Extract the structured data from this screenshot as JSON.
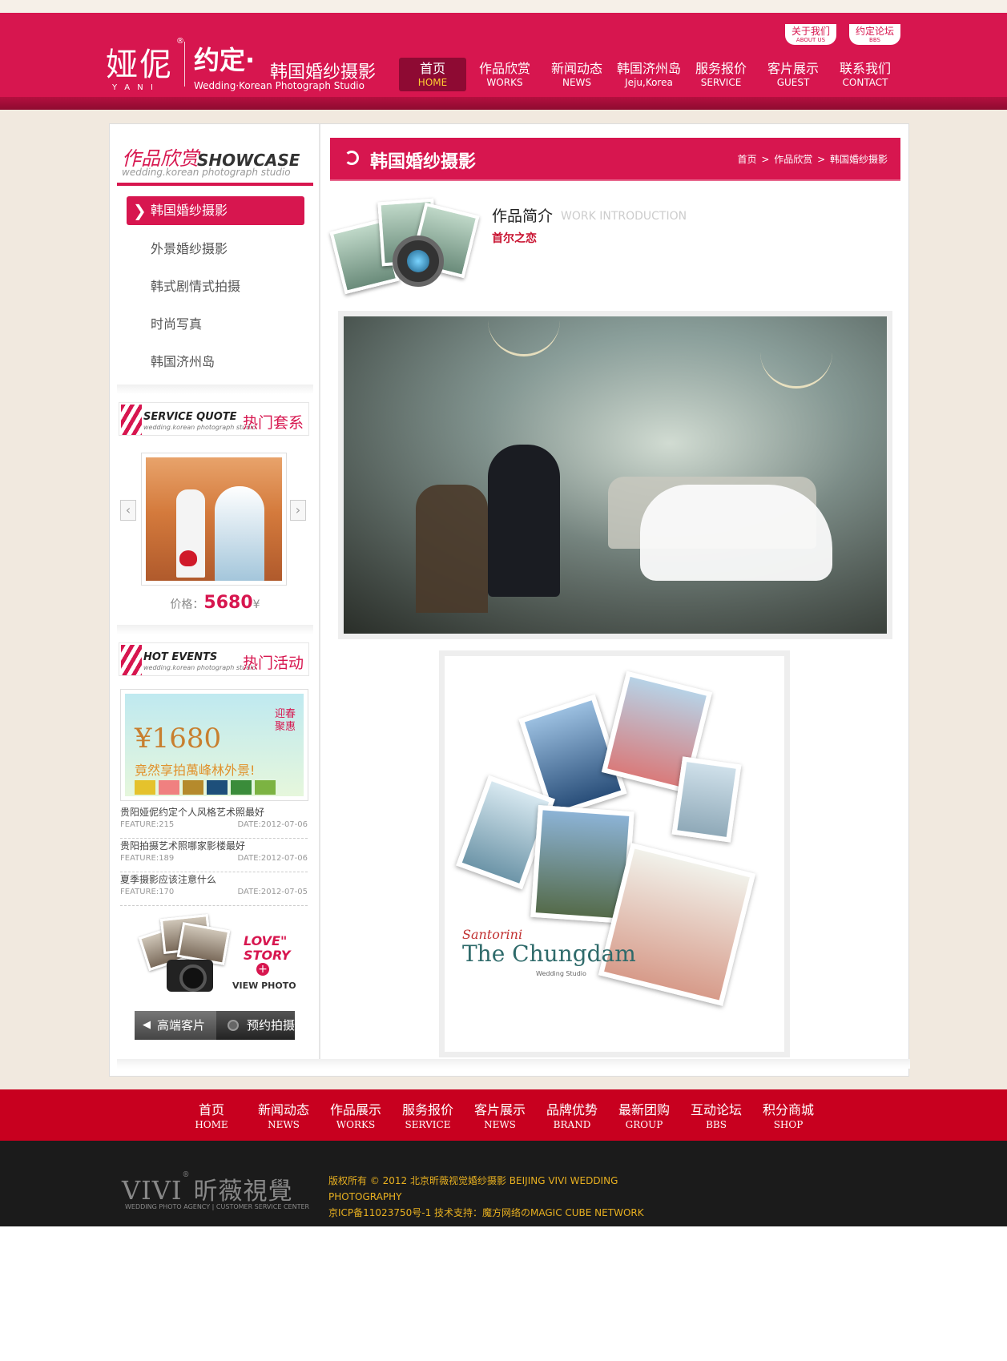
{
  "header": {
    "logo_main": "娅伲",
    "logo_reg": "®",
    "logo_yani": "Y A N I",
    "logo_yueding": "约定·",
    "logo_cn": "韩国婚纱摄影",
    "logo_en": "Wedding·Korean Photograph Studio",
    "top_links": [
      {
        "cn": "关于我们",
        "en": "ABOUT US"
      },
      {
        "cn": "约定论坛",
        "en": "BBS"
      }
    ],
    "nav": [
      {
        "cn": "首页",
        "en": "HOME"
      },
      {
        "cn": "作品欣赏",
        "en": "WORKS"
      },
      {
        "cn": "新闻动态",
        "en": "NEWS"
      },
      {
        "cn": "韩国济州岛",
        "en": "Jeju,Korea"
      },
      {
        "cn": "服务报价",
        "en": "SERVICE"
      },
      {
        "cn": "客片展示",
        "en": "GUEST"
      },
      {
        "cn": "联系我们",
        "en": "CONTACT"
      }
    ]
  },
  "sidebar": {
    "title_cn": "作品欣赏",
    "title_en": "SHOWCASE",
    "title_sub": "wedding.korean photograph studio",
    "menu": [
      "韩国婚纱摄影",
      "外景婚纱摄影",
      "韩式剧情式拍摄",
      "时尚写真",
      "韩国济州岛"
    ],
    "service": {
      "title_en": "SERVICE QUOTE",
      "title_sub": "wedding.korean photograph studio",
      "title_cn": "热门套系",
      "price_label": "价格：",
      "price_value": "5680",
      "price_unit": "¥",
      "prev": "‹",
      "next": "›"
    },
    "events": {
      "title_en": "HOT EVENTS",
      "title_sub": "wedding.korean photograph studio",
      "title_cn": "热门活动",
      "banner_price": "¥1680",
      "banner_slogan": "竟然享拍萬峰林外景!",
      "banner_seal": "迎春聚惠",
      "news": [
        {
          "title": "贵阳娅伲约定个人风格艺术照最好",
          "feature": "FEATURE:215",
          "date": "DATE:2012-07-06"
        },
        {
          "title": "贵阳拍摄艺术照哪家影楼最好",
          "feature": "FEATURE:189",
          "date": "DATE:2012-07-06"
        },
        {
          "title": "夏季摄影应该注意什么",
          "feature": "FEATURE:170",
          "date": "DATE:2012-07-05"
        }
      ]
    },
    "love_story": {
      "title1": "LOVE\"",
      "title2": "STORY",
      "plus": "+",
      "view": "VIEW PHOTO"
    },
    "btn_clients": "高端客片",
    "btn_book": "预约拍摄",
    "btn_arrow": "◀"
  },
  "content": {
    "title": "韩国婚纱摄影",
    "breadcrumb": [
      "首页",
      ">",
      "作品欣赏",
      ">",
      "韩国婚纱摄影"
    ],
    "intro_title": "作品简介",
    "intro_en": "WORK INTRODUCTION",
    "intro_sub": "首尔之恋",
    "collage_text1": "Santorini",
    "collage_text2": "The Chungdam",
    "collage_text3": "Wedding Studio"
  },
  "footer": {
    "nav": [
      {
        "cn": "首页",
        "en": "HOME"
      },
      {
        "cn": "新闻动态",
        "en": "NEWS"
      },
      {
        "cn": "作品展示",
        "en": "WORKS"
      },
      {
        "cn": "服务报价",
        "en": "SERVICE"
      },
      {
        "cn": "客片展示",
        "en": "NEWS"
      },
      {
        "cn": "品牌优势",
        "en": "BRAND"
      },
      {
        "cn": "最新团购",
        "en": "GROUP"
      },
      {
        "cn": "互动论坛",
        "en": "BBS"
      },
      {
        "cn": "积分商城",
        "en": "SHOP"
      }
    ],
    "logo_en": "VIVI",
    "logo_reg": "®",
    "logo_cn": "昕薇視覺",
    "logo_sub": "WEDDING PHOTO AGENCY | CUSTOMER SERVICE CENTER",
    "copyright1": "版权所有 © 2012 北京昕薇视觉婚纱摄影 BEIJING VIVI WEDDING PHOTOGRAPHY",
    "copyright2": "京ICP备11023750号-1 技术支持：魔方网络のMAGIC CUBE NETWORK"
  },
  "colors": {
    "brand": "#d7164f",
    "footer_red": "#c8001f",
    "footer_dark": "#1b1b1b",
    "active_nav": "#8e0a33"
  }
}
